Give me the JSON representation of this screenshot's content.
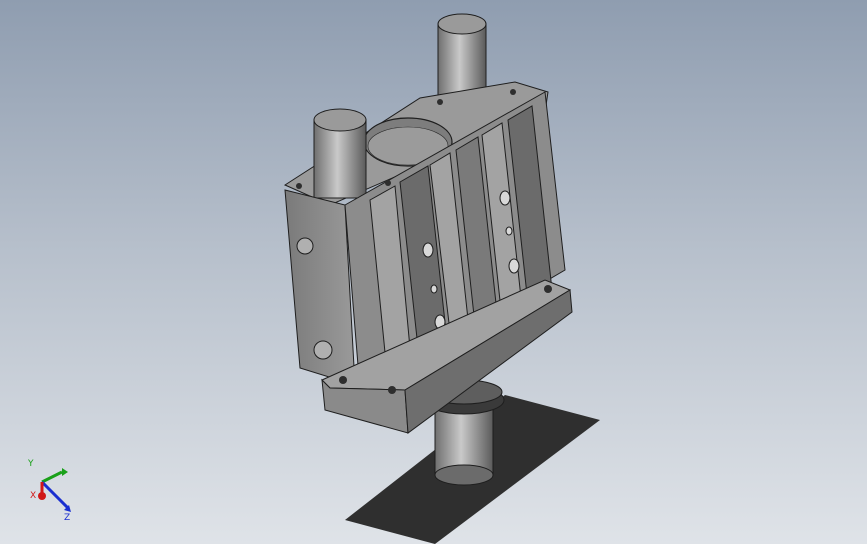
{
  "viewport": {
    "background_top": "#8f9db0",
    "background_bottom": "#dfe3e8"
  },
  "model": {
    "body_color": "#8c8c8c",
    "body_dark": "#5e5e5e",
    "body_light": "#b5b5b5",
    "edge_color": "#1e1e1e",
    "shadow_color": "#2b2b2b"
  },
  "triad": {
    "x_label": "X",
    "y_label": "Y",
    "z_label": "Z",
    "x_color": "#d01818",
    "y_color": "#19a019",
    "z_color": "#1a2fd0",
    "icon": "coordinate-triad-icon"
  }
}
